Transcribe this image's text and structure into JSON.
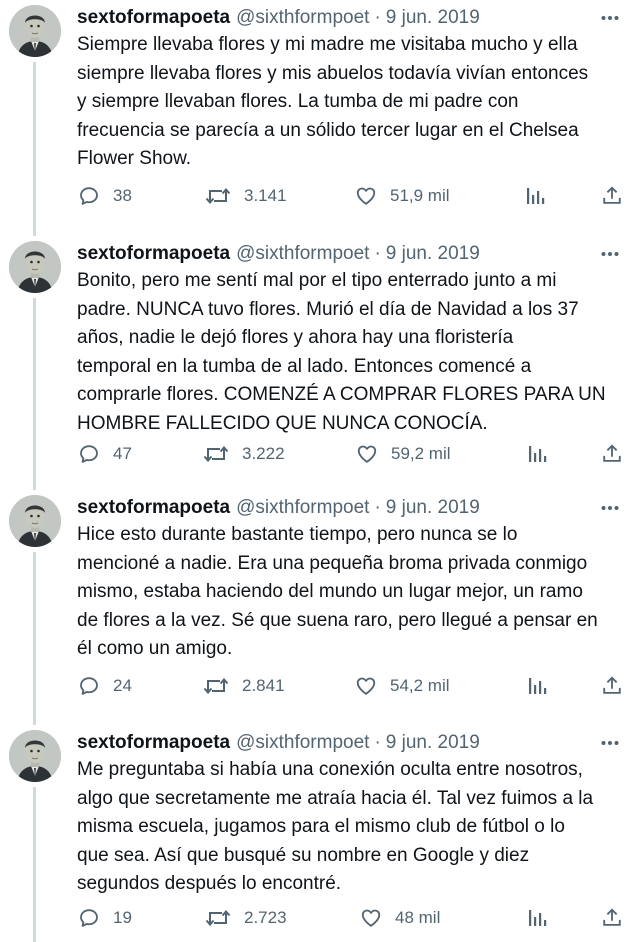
{
  "colors": {
    "text": "#0f1419",
    "secondary": "#536471",
    "thread_line": "#cfd9de"
  },
  "tweets": [
    {
      "name": "sextoformapoeta",
      "handle": "@sixthformpoet",
      "dot": "·",
      "date": "9 jun. 2019",
      "text": "Siempre llevaba flores y mi madre me visitaba mucho y ella\nsiempre llevaba flores y mis abuelos todavía vivían entonces\ny siempre llevaban flores. La tumba de mi padre con\nfrecuencia se parecía a un sólido tercer lugar en el Chelsea\nFlower Show.",
      "replies": "38",
      "retweets": "3.141",
      "likes": "51,9 mil"
    },
    {
      "name": "sextoformapoeta",
      "handle": "@sixthformpoet",
      "dot": "·",
      "date": "9 jun. 2019",
      "text": "Bonito, pero me sentí mal por el tipo enterrado junto a mi\npadre. NUNCA tuvo flores. Murió el día de Navidad a los 37\naños, nadie le dejó flores y ahora hay una floristería\ntemporal en la tumba de al lado. Entonces comencé a\ncomprarle flores. COMENZÉ A COMPRAR FLORES PARA UN\nHOMBRE FALLECIDO QUE NUNCA CONOCÍA.",
      "replies": "47",
      "retweets": "3.222",
      "likes": "59,2 mil"
    },
    {
      "name": "sextoformapoeta",
      "handle": "@sixthformpoet",
      "dot": "·",
      "date": "9 jun. 2019",
      "text": "Hice esto durante bastante tiempo, pero nunca se lo\nmencioné a nadie. Era una pequeña broma privada conmigo\nmismo, estaba haciendo del mundo un lugar mejor, un ramo\nde flores a la vez. Sé que suena raro, pero llegué a pensar en\nél como un amigo.",
      "replies": "24",
      "retweets": "2.841",
      "likes": "54,2 mil"
    },
    {
      "name": "sextoformapoeta",
      "handle": "@sixthformpoet",
      "dot": "·",
      "date": "9 jun. 2019",
      "text": "Me preguntaba si había una conexión oculta entre nosotros,\nalgo que secretamente me atraía hacia él. Tal vez fuimos a la\nmisma escuela, jugamos para el mismo club de fútbol o lo\nque sea. Así que busqué su nombre en Google y diez\nsegundos después lo encontré.",
      "replies": "19",
      "retweets": "2.723",
      "likes": "48 mil"
    }
  ]
}
